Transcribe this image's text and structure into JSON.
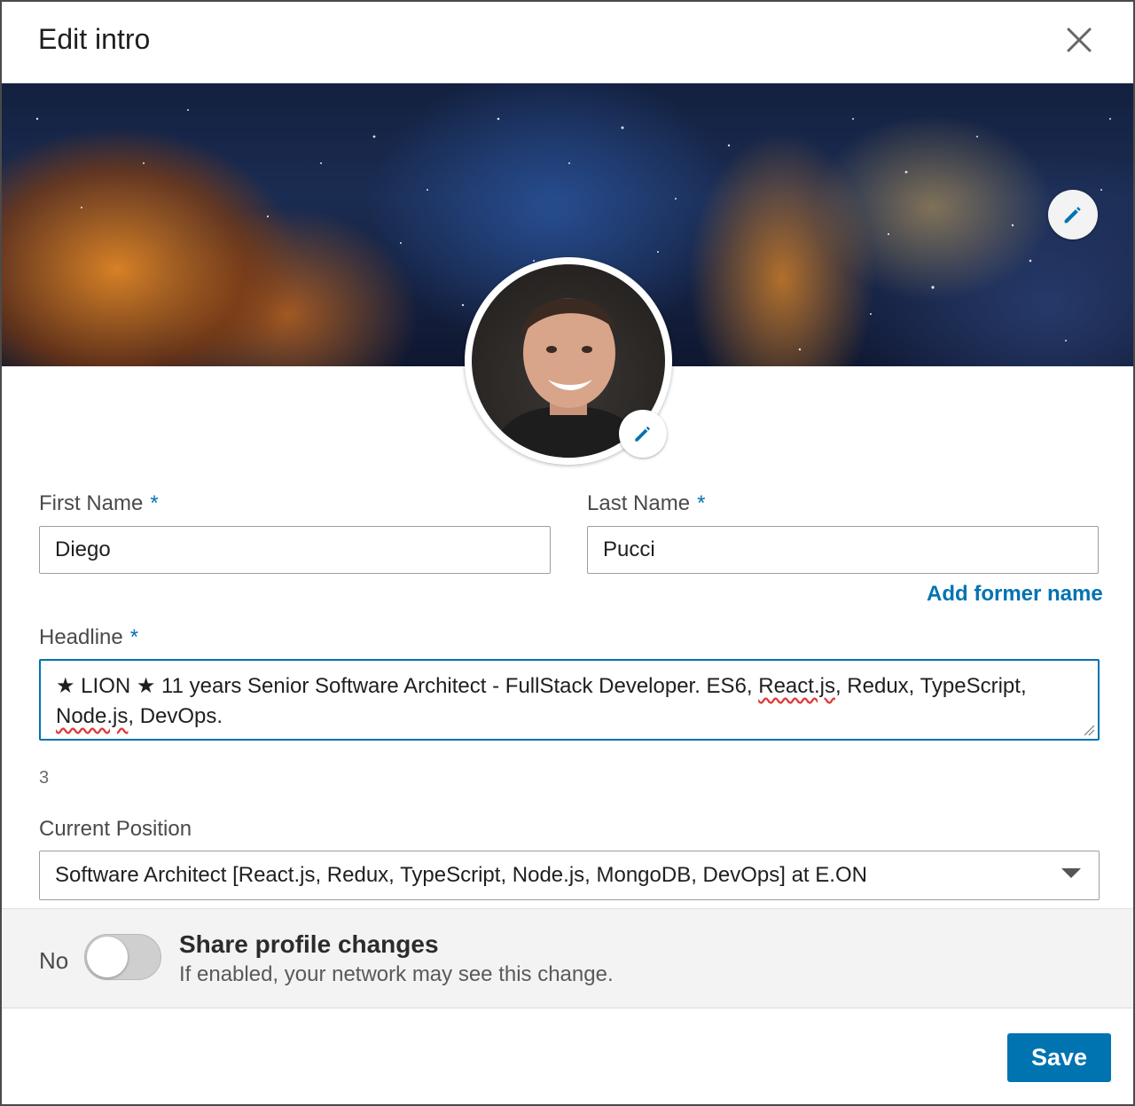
{
  "dialog": {
    "title": "Edit intro",
    "close_icon": "close-icon"
  },
  "banner": {
    "edit_icon": "pencil-icon"
  },
  "avatar": {
    "edit_icon": "pencil-icon"
  },
  "form": {
    "required_mark": "*",
    "first_name": {
      "label": "First Name",
      "value": "Diego"
    },
    "last_name": {
      "label": "Last Name",
      "value": "Pucci"
    },
    "add_former_name": "Add former name",
    "headline": {
      "label": "Headline",
      "parts": [
        "★ LION ★ 11 years Senior Software Architect - FullStack Developer. ES6, ",
        "React.js",
        ", Redux, TypeScript, ",
        "Node.js",
        ", DevOps."
      ],
      "counter": "3"
    },
    "current_position": {
      "label": "Current Position",
      "value": "Software Architect [React.js, Redux, TypeScript, Node.js, MongoDB, DevOps] at E.ON"
    }
  },
  "share": {
    "toggle_state": "No",
    "title": "Share profile changes",
    "subtitle": "If enabled, your network may see this change."
  },
  "footer": {
    "save_label": "Save"
  },
  "colors": {
    "accent": "#0073b1",
    "toggle_off": "#cfcfcf",
    "share_bg": "#f3f3f3"
  }
}
